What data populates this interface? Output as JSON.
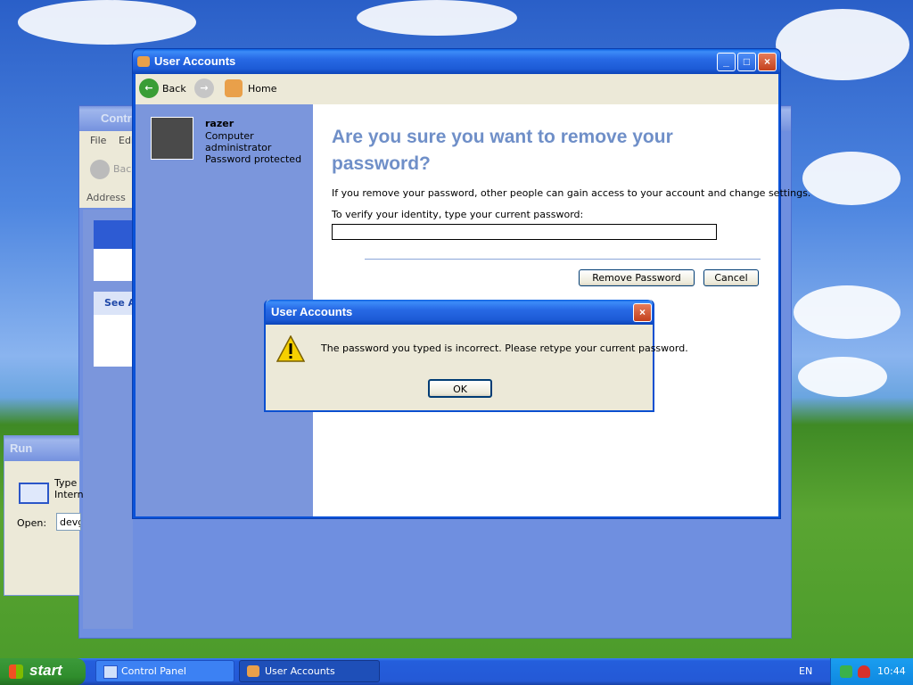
{
  "background_control_panel": {
    "title": "Control Panel",
    "menu": [
      "File",
      "Edit"
    ],
    "back_label": "Back",
    "address_label": "Address",
    "see_also": "See Also"
  },
  "run_dialog": {
    "title": "Run",
    "description_line1": "Type",
    "description_line2": "Intern",
    "open_label": "Open:",
    "open_value": "devg"
  },
  "user_accounts": {
    "title": "User Accounts",
    "toolbar": {
      "back_label": "Back",
      "home_label": "Home"
    },
    "account": {
      "name": "razer",
      "type_line1": "Computer",
      "type_line2": "administrator",
      "status": "Password protected"
    },
    "heading": "Are you sure you want to remove your password?",
    "warning_text": "If you remove your password, other people can gain access to your account and change settings.",
    "verify_label": "To verify your identity, type your current password:",
    "password_value": "",
    "remove_button": "Remove Password",
    "cancel_button": "Cancel"
  },
  "error_dialog": {
    "title": "User Accounts",
    "message": "The password you typed is incorrect. Please retype your current password.",
    "ok_button": "OK"
  },
  "taskbar": {
    "start_label": "start",
    "tasks": [
      {
        "label": "Control Panel",
        "active": false
      },
      {
        "label": "User Accounts",
        "active": true
      }
    ],
    "language": "EN",
    "clock": "10:44"
  },
  "colors": {
    "title_active": "#0a5ee0",
    "heading_blue": "#6f8fc8",
    "sidebar": "#7b96dc"
  }
}
